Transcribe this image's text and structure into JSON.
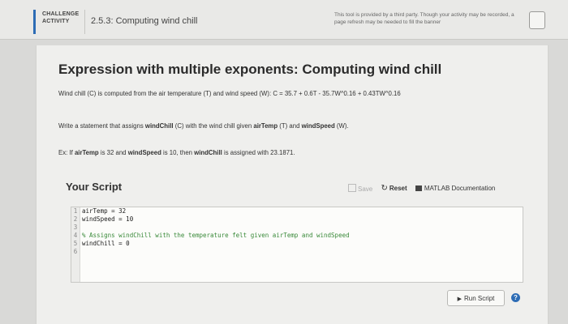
{
  "header": {
    "label_line1": "CHALLENGE",
    "label_line2": "ACTIVITY",
    "activity_title": "2.5.3: Computing wind chill",
    "notice": "This tool is provided by a third party. Though your activity may be recorded, a page refresh may be needed to fill the banner"
  },
  "problem": {
    "title": "Expression with multiple exponents: Computing wind chill",
    "formula_text": "Wind chill (C) is computed from the air temperature (T) and wind speed (W): C = 35.7 + 0.6T - 35.7W^0.16 + 0.43TW^0.16",
    "instruction": {
      "t1": "Write a statement that assigns ",
      "b1": "windChill",
      "t2": " (C) with the wind chill given ",
      "b2": "airTemp",
      "t3": " (T) and ",
      "b3": "windSpeed",
      "t4": " (W)."
    },
    "example": {
      "t1": "Ex: If ",
      "b1": "airTemp",
      "t2": " is 32 and ",
      "b2": "windSpeed",
      "t3": " is 10, then ",
      "b3": "windChill",
      "t4": " is assigned with 23.1871."
    }
  },
  "script": {
    "title": "Your Script",
    "save_label": "Save",
    "reset_label": "Reset",
    "docs_label": "MATLAB Documentation",
    "lines": [
      {
        "num": "1",
        "code": "airTemp = 32"
      },
      {
        "num": "2",
        "code": "windSpeed = 10"
      },
      {
        "num": "3",
        "code": ""
      },
      {
        "num": "4",
        "code": "% Assigns windChill with the temperature felt given airTemp and windSpeed"
      },
      {
        "num": "5",
        "code": "windChill = 0"
      },
      {
        "num": "6",
        "code": ""
      }
    ],
    "run_label": "Run Script",
    "help_glyph": "?"
  },
  "colors": {
    "accent": "#2d6cb5",
    "comment": "#3a8a3a"
  },
  "icons": {
    "save": "save-icon",
    "reset": "reset-icon",
    "docs": "book-icon",
    "run": "play-icon",
    "help": "help-icon"
  }
}
